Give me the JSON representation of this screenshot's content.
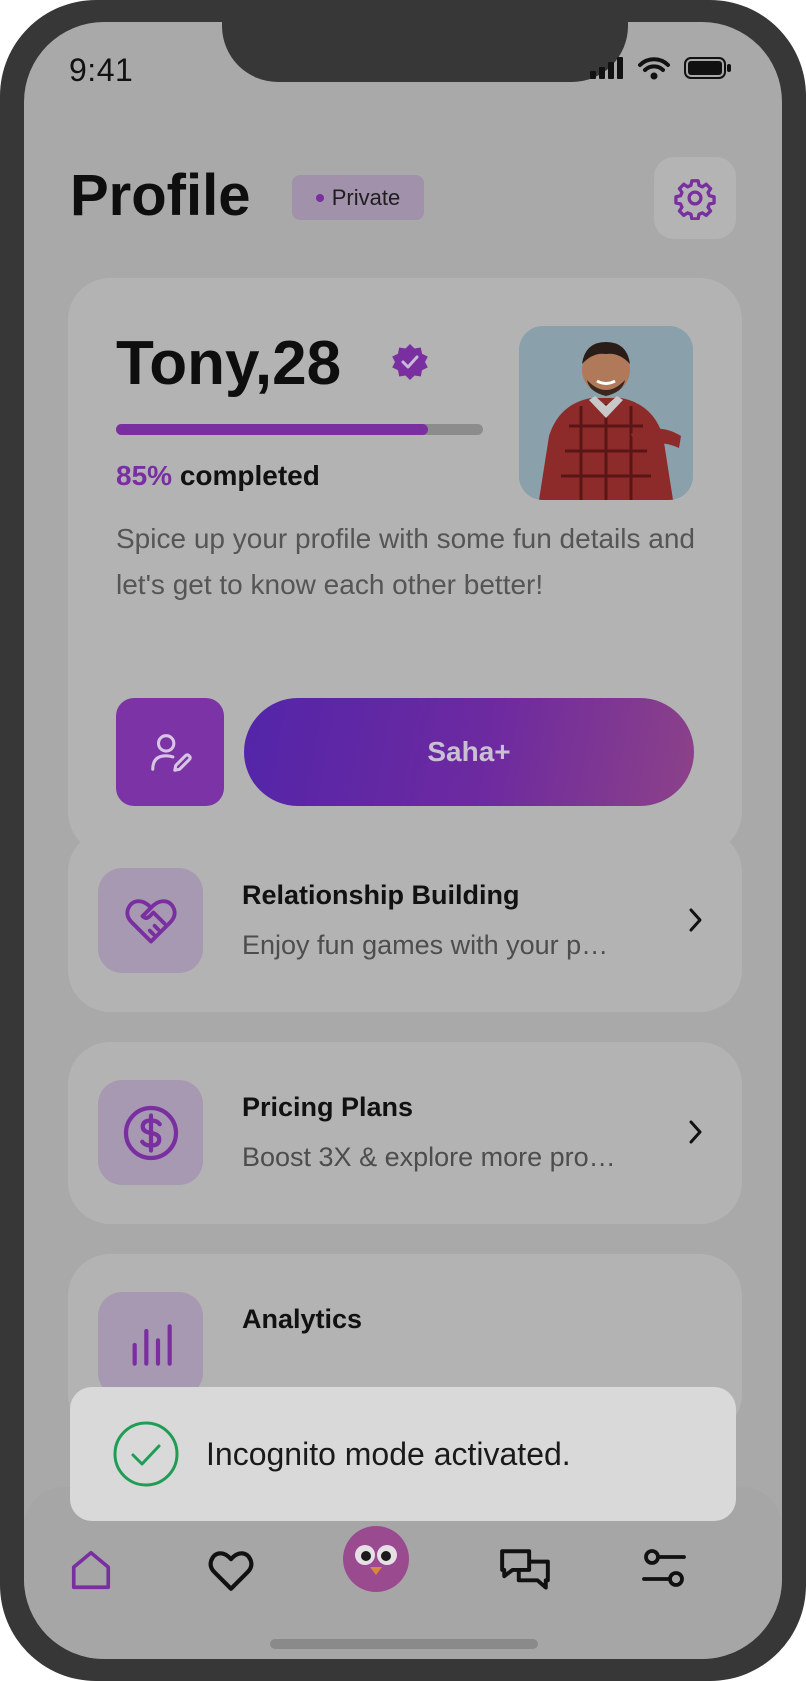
{
  "status_bar": {
    "time": "9:41"
  },
  "header": {
    "title": "Profile",
    "badge_label": "Private"
  },
  "profile": {
    "name": "Tony,28",
    "progress_value": 85,
    "progress_percent_label": "85%",
    "progress_suffix": "completed",
    "description": "Spice up your profile with some fun details and let's get to know each other better!",
    "cta_label": "Saha+"
  },
  "menu": [
    {
      "title": "Relationship Building",
      "subtitle": "Enjoy fun games with your p…",
      "icon": "heart-handshake-icon"
    },
    {
      "title": "Pricing Plans",
      "subtitle": "Boost 3X & explore more pro…",
      "icon": "dollar-circle-icon"
    },
    {
      "title": "Analytics",
      "subtitle": "",
      "icon": "chart-icon"
    }
  ],
  "toast": {
    "message": "Incognito mode activated."
  },
  "nav": [
    "home-icon",
    "heart-icon",
    "mascot-avatar",
    "chat-icon",
    "filters-icon"
  ],
  "colors": {
    "accent": "#7a2fa0",
    "background": "#a9a9a9",
    "card": "#b3b3b3",
    "success": "#1f9d55"
  }
}
